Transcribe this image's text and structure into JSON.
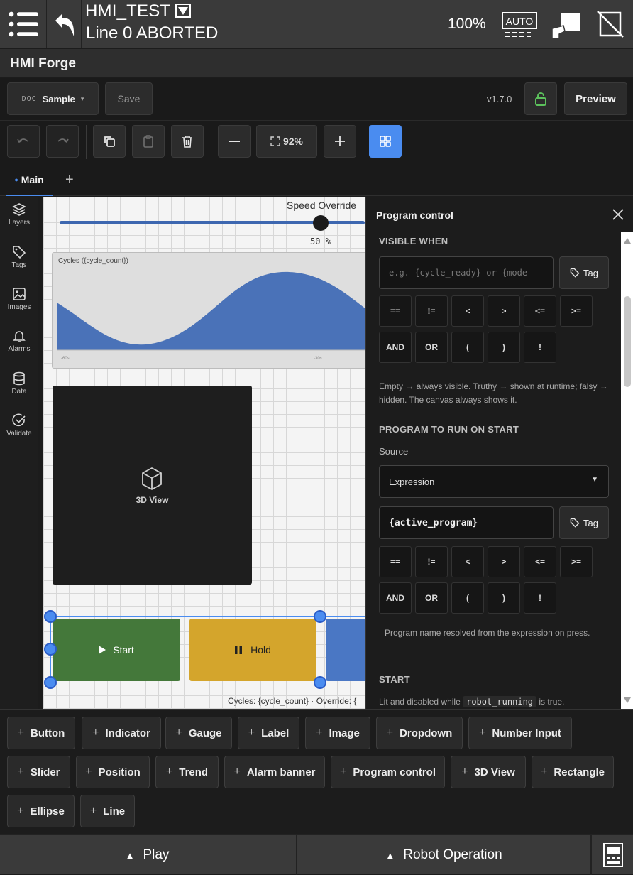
{
  "topbar": {
    "program_name": "HMI_TEST",
    "line_status": "Line 0 ABORTED",
    "speed": "100%",
    "mode_label": "AUTO"
  },
  "app": {
    "title": "HMI Forge"
  },
  "toolbar": {
    "doc_label": "DOC",
    "doc_value": "Sample",
    "save_label": "Save",
    "version": "v1.7.0",
    "preview_label": "Preview",
    "zoom": "92%"
  },
  "tabs": {
    "main_label": "Main",
    "add_label": "+"
  },
  "sidebar": {
    "items": [
      {
        "label": "Layers",
        "icon": "layers-icon"
      },
      {
        "label": "Tags",
        "icon": "tag-icon"
      },
      {
        "label": "Images",
        "icon": "image-icon"
      },
      {
        "label": "Alarms",
        "icon": "bell-icon"
      },
      {
        "label": "Data",
        "icon": "database-icon"
      },
      {
        "label": "Validate",
        "icon": "check-circle-icon"
      }
    ]
  },
  "canvas": {
    "speed_label": "Speed Override",
    "speed_value": "50 %",
    "speed_fraction": 0.5,
    "trend_title": "Cycles ({cycle_count})",
    "trend_tick_left": "-60s",
    "trend_tick_mid": "-30s",
    "view3d_label": "3D View",
    "start_label": "Start",
    "hold_label": "Hold",
    "footer": "Cycles: {cycle_count} · Override: {"
  },
  "panel": {
    "title": "Program control",
    "visible_when_title": "VISIBLE WHEN",
    "visible_placeholder": "e.g. {cycle_ready} or {mode",
    "tag_label": "Tag",
    "operators_row1": [
      "==",
      "!=",
      "<",
      ">",
      "<=",
      ">="
    ],
    "operators_row2": [
      "AND",
      "OR",
      "(",
      ")",
      "!"
    ],
    "visible_help": "Empty → always visible. Truthy → shown at runtime; falsy → hidden. The canvas always shows it.",
    "program_title": "PROGRAM TO RUN ON START",
    "source_label": "Source",
    "source_value": "Expression",
    "expression_value": "{active_program}",
    "program_help": "Program name resolved from the expression on press.",
    "start_title": "START",
    "start_help_pre": "Lit and disabled while",
    "start_help_code": "robot_running",
    "start_help_post": "is true."
  },
  "palette": {
    "items": [
      "Button",
      "Indicator",
      "Gauge",
      "Label",
      "Image",
      "Dropdown",
      "Number Input",
      "Slider",
      "Position",
      "Trend",
      "Alarm banner",
      "Program control",
      "3D View",
      "Rectangle",
      "Ellipse",
      "Line"
    ]
  },
  "bottombar": {
    "play_label": "Play",
    "robot_op_label": "Robot Operation"
  },
  "colors": {
    "accent": "#4a8cf0",
    "start": "#44783a",
    "hold": "#d4a52c",
    "stop": "#4a77c4",
    "lock": "#5cc15c"
  }
}
